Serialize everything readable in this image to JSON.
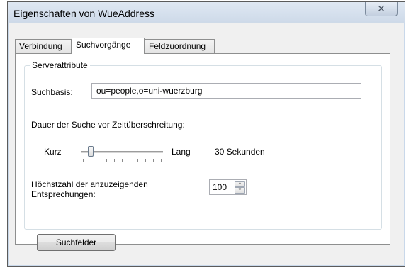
{
  "window": {
    "title": "Eigenschaften von WueAddress",
    "close_glyph": "✕"
  },
  "tabs": [
    {
      "label": "Verbindung",
      "active": false
    },
    {
      "label": "Suchvorgänge",
      "active": true
    },
    {
      "label": "Feldzuordnung",
      "active": false
    }
  ],
  "server_attributes": {
    "group_label": "Serverattribute",
    "search_base_label": "Suchbasis:",
    "search_base_value": "ou=people,o=uni-wuerzburg",
    "timeout_label": "Dauer der Suche vor Zeitüberschreitung:",
    "slider_min_label": "Kurz",
    "slider_max_label": "Lang",
    "slider_value_text": "30 Sekunden",
    "slider_level": 0.1,
    "max_results_label": "Höchstzahl der anzuzeigenden Entsprechungen:",
    "max_results_value": "100",
    "spin_up_glyph": "▲",
    "spin_down_glyph": "▼"
  },
  "buttons": {
    "search_fields": "Suchfelder"
  }
}
